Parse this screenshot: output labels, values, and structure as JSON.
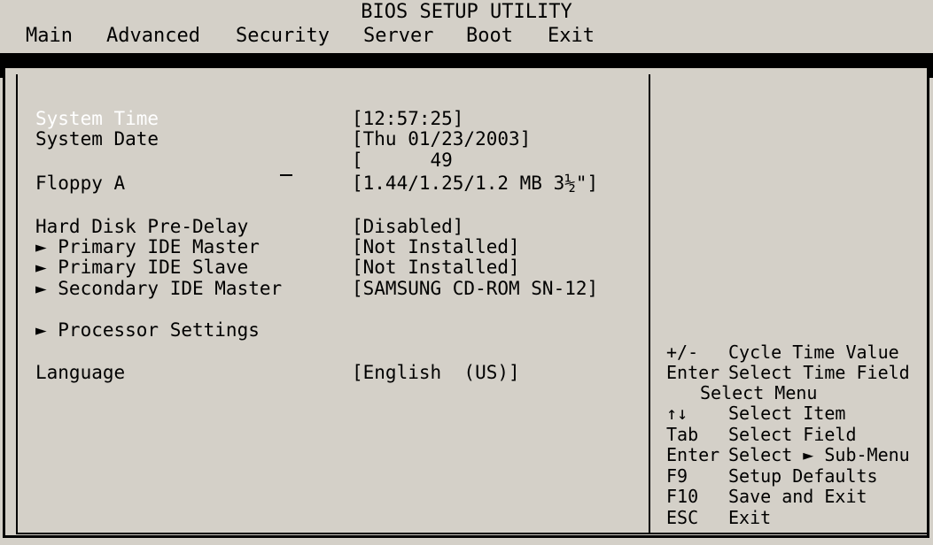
{
  "header": {
    "title": "BIOS SETUP UTILITY",
    "tabs": [
      "Main",
      "Advanced",
      "Security",
      "Server",
      "Boot",
      "Exit"
    ]
  },
  "settings": {
    "system_time": {
      "label": "System Time",
      "value": "[12:57:25]"
    },
    "system_date": {
      "label": "System Date",
      "value": "[Thu 01/23/2003]"
    },
    "stray_value": "[      49",
    "floppy_a": {
      "label": "Floppy A",
      "value": "[1.44/1.25/1.2 MB 3½\"]"
    },
    "hard_disk_pre_delay": {
      "label": "Hard Disk Pre-Delay",
      "value": "[Disabled]"
    },
    "primary_ide_master": {
      "label": "► Primary IDE Master",
      "value": "[Not Installed]"
    },
    "primary_ide_slave": {
      "label": "► Primary IDE Slave",
      "value": "[Not Installed]"
    },
    "secondary_ide_master": {
      "label": "► Secondary IDE Master",
      "value": "[SAMSUNG CD-ROM SN-12]"
    },
    "processor_settings": {
      "label": "► Processor Settings"
    },
    "language": {
      "label": "Language",
      "value": "[English  (US)]"
    }
  },
  "help": {
    "cycle": {
      "key": "+/-",
      "text": "Cycle Time Value"
    },
    "enter_field": {
      "key": "Enter",
      "text": "Select Time Field"
    },
    "select_menu": "Select Menu",
    "arrows": {
      "key": "↑↓",
      "text": "Select Item"
    },
    "tab": {
      "key": "Tab",
      "text": "Select Field"
    },
    "enter_sub": {
      "key": "Enter",
      "text": "Select ► Sub-Menu"
    },
    "f9": {
      "key": "F9",
      "text": "Setup Defaults"
    },
    "f10": {
      "key": "F10",
      "text": "Save and Exit"
    },
    "esc": {
      "key": "ESC",
      "text": "Exit"
    }
  },
  "colors": {
    "background": "#d4d0c8",
    "selected_text": "#ffffff",
    "border": "#000000"
  }
}
